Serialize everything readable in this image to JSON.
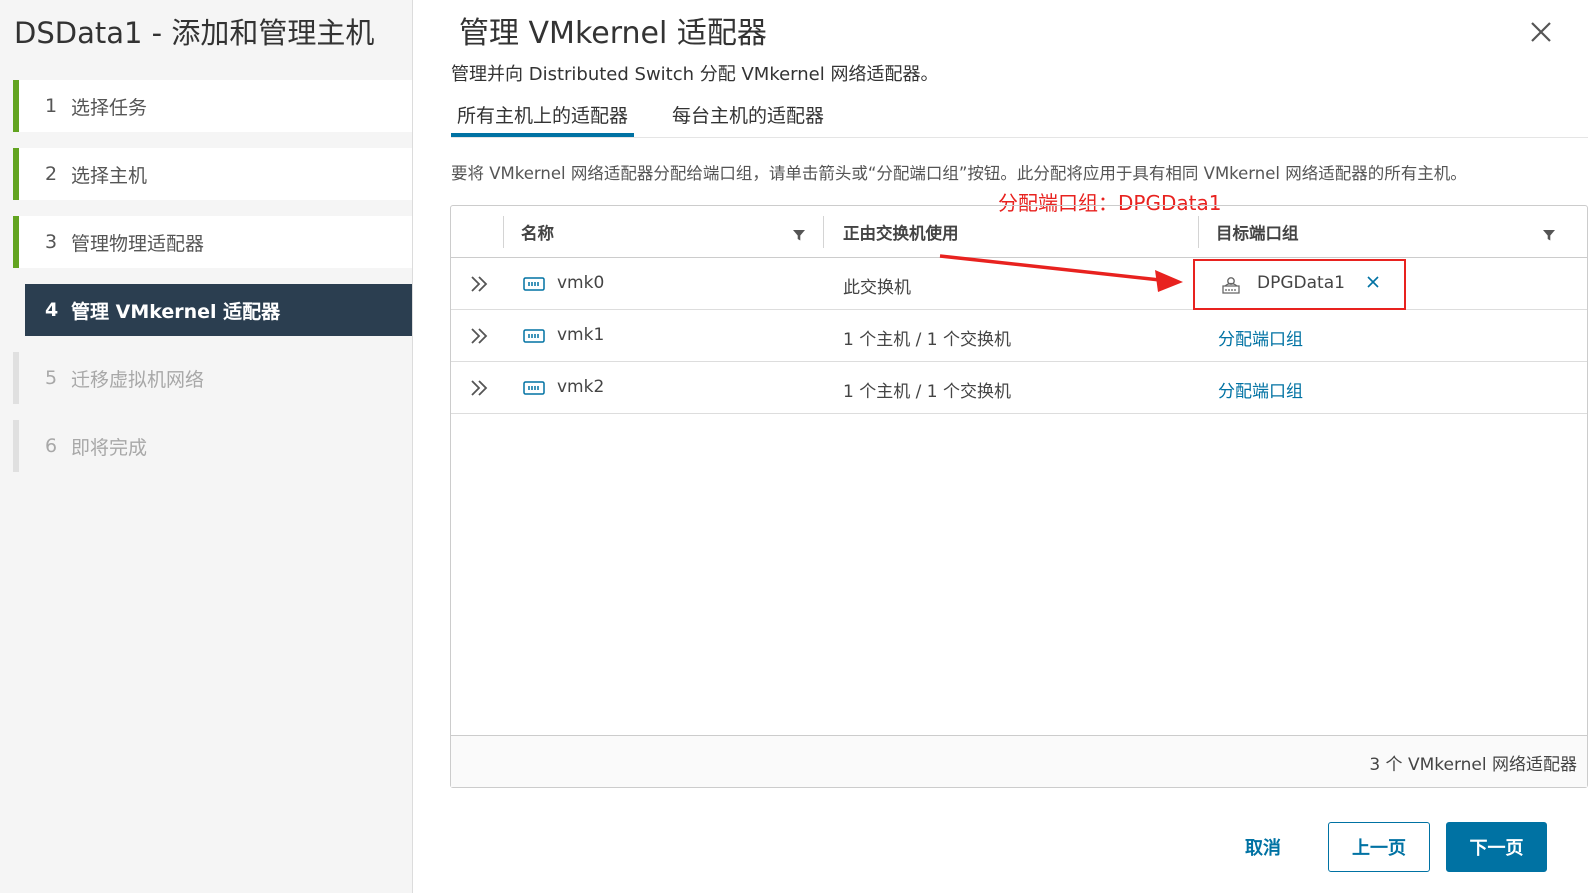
{
  "wizard": {
    "title": "DSData1 - 添加和管理主机",
    "steps": [
      {
        "num": "1",
        "label": "选择任务"
      },
      {
        "num": "2",
        "label": "选择主机"
      },
      {
        "num": "3",
        "label": "管理物理适配器"
      },
      {
        "num": "4",
        "label": "管理 VMkernel 适配器"
      },
      {
        "num": "5",
        "label": "迁移虚拟机网络"
      },
      {
        "num": "6",
        "label": "即将完成"
      }
    ]
  },
  "page": {
    "title": "管理 VMkernel 适配器",
    "subtitle": "管理并向 Distributed Switch 分配 VMkernel 网络适配器。",
    "tabs": [
      "所有主机上的适配器",
      "每台主机的适配器"
    ],
    "instruction": "要将 VMkernel 网络适配器分配给端口组，请单击箭头或“分配端口组”按钮。此分配将应用于具有相同 VMkernel 网络适配器的所有主机。"
  },
  "annotation": "分配端口组：DPGData1",
  "grid": {
    "columns": [
      "名称",
      "正由交换机使用",
      "目标端口组"
    ],
    "rows": [
      {
        "name": "vmk0",
        "in_use": "此交换机",
        "target": "DPGData1"
      },
      {
        "name": "vmk1",
        "in_use": "1 个主机 / 1 个交换机",
        "target": "分配端口组"
      },
      {
        "name": "vmk2",
        "in_use": "1 个主机 / 1 个交换机",
        "target": "分配端口组"
      }
    ],
    "footer": "3 个 VMkernel 网络适配器"
  },
  "buttons": {
    "cancel": "取消",
    "back": "上一页",
    "next": "下一页"
  },
  "colors": {
    "accent": "#0072a3",
    "done_step": "#62a420",
    "active_step_bg": "#2b3e50",
    "annotation": "#e8221f"
  }
}
